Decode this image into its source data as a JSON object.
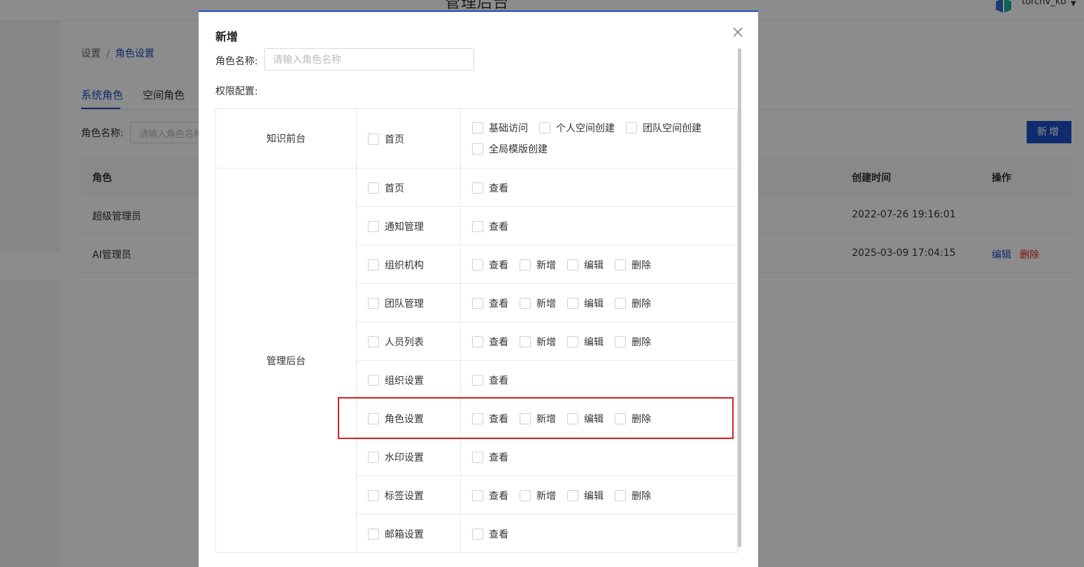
{
  "header": {
    "app_title": "管理后台",
    "username": "torchv_kb",
    "logo_icon": "torchv-logo-icon",
    "caret_icon": "caret-down-icon"
  },
  "page": {
    "breadcrumb": {
      "root": "设置",
      "separator": "/",
      "current": "角色设置"
    },
    "tabs": [
      "系统角色",
      "空间角色"
    ],
    "filter": {
      "label": "角色名称:",
      "placeholder": "请输入角色名称"
    },
    "add_button": "新增",
    "table": {
      "columns": {
        "role": "角色",
        "created": "创建时间",
        "actions": "操作"
      },
      "rows": [
        {
          "role": "超级管理员",
          "created": "2022-07-26 19:16:01",
          "edit": "",
          "delete": ""
        },
        {
          "role": "AI管理员",
          "created": "2025-03-09 17:04:15",
          "edit": "编辑",
          "delete": "删除"
        }
      ]
    }
  },
  "modal": {
    "title": "新增",
    "name_label": "角色名称:",
    "name_placeholder": "请输入角色名称",
    "name_value": "",
    "perm_label": "权限配置:",
    "groups": [
      {
        "name": "知识前台",
        "rows": [
          {
            "module": "首页",
            "actions": [
              "基础访问",
              "个人空间创建",
              "团队空间创建",
              "全局模版创建"
            ]
          }
        ]
      },
      {
        "name": "管理后台",
        "rows": [
          {
            "module": "首页",
            "actions": [
              "查看"
            ]
          },
          {
            "module": "通知管理",
            "actions": [
              "查看"
            ]
          },
          {
            "module": "组织机构",
            "actions": [
              "查看",
              "新增",
              "编辑",
              "删除"
            ]
          },
          {
            "module": "团队管理",
            "actions": [
              "查看",
              "新增",
              "编辑",
              "删除"
            ]
          },
          {
            "module": "人员列表",
            "actions": [
              "查看",
              "新增",
              "编辑",
              "删除"
            ]
          },
          {
            "module": "组织设置",
            "actions": [
              "查看"
            ]
          },
          {
            "module": "角色设置",
            "actions": [
              "查看",
              "新增",
              "编辑",
              "删除"
            ],
            "highlighted": true
          },
          {
            "module": "水印设置",
            "actions": [
              "查看"
            ]
          },
          {
            "module": "标签设置",
            "actions": [
              "查看",
              "新增",
              "编辑",
              "删除"
            ]
          },
          {
            "module": "邮箱设置",
            "actions": [
              "查看"
            ]
          }
        ]
      }
    ]
  },
  "colors": {
    "primary": "#1e50c8",
    "danger": "#e02020",
    "highlight": "#e02020"
  }
}
